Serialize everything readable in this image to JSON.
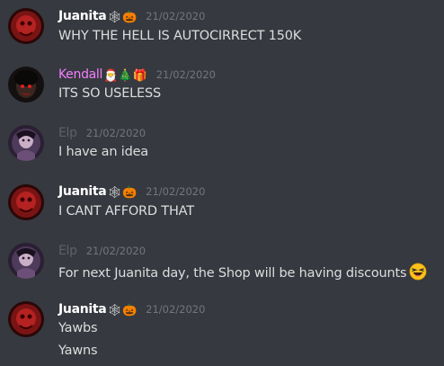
{
  "colors": {
    "background": "#36393f",
    "text": "#dcddde",
    "timestamp": "#72767d",
    "juanita": "#ffffff",
    "kendall": "#f47fff",
    "elp": "#5e6168"
  },
  "messages": [
    {
      "author": "Juanita",
      "badges": "🕸🎃",
      "timestamp": "21/02/2020",
      "lines": [
        "WHY THE HELL IS AUTOCIRRECT 150K"
      ]
    },
    {
      "author": "Kendall",
      "badges": "🎅🎄🎁",
      "timestamp": "21/02/2020",
      "lines": [
        "ITS SO USELESS"
      ]
    },
    {
      "author": "Elp",
      "timestamp": "21/02/2020",
      "lines": [
        "I have an idea"
      ]
    },
    {
      "author": "Juanita",
      "badges": "🕸🎃",
      "timestamp": "21/02/2020",
      "lines": [
        "I CANT AFFORD THAT"
      ]
    },
    {
      "author": "Elp",
      "timestamp": "21/02/2020",
      "lines": [
        "For next Juanita day, the Shop will be having discounts"
      ],
      "emoji": "laughing-emoji"
    },
    {
      "author": "Juanita",
      "badges": "🕸🎃",
      "timestamp": "21/02/2020",
      "lines": [
        "Yawbs",
        "Yawns"
      ]
    }
  ]
}
